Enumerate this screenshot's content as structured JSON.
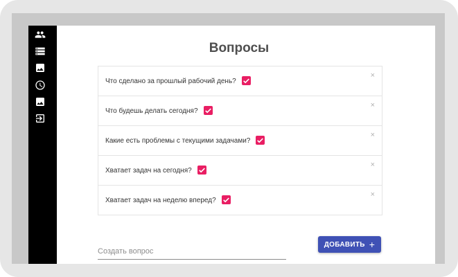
{
  "page": {
    "title": "Вопросы"
  },
  "sidebar": {
    "items": [
      {
        "icon": "people-icon"
      },
      {
        "icon": "storage-icon"
      },
      {
        "icon": "image-icon"
      },
      {
        "icon": "clock-icon"
      },
      {
        "icon": "image-icon"
      },
      {
        "icon": "exit-icon"
      }
    ]
  },
  "questions": [
    {
      "text": "Что сделано за прошлый рабочий день?",
      "checked": true,
      "remove": "×"
    },
    {
      "text": "Что будешь делать сегодня?",
      "checked": true,
      "remove": "×"
    },
    {
      "text": "Какие есть проблемы с текущими задачами?",
      "checked": true,
      "remove": "×"
    },
    {
      "text": "Хватает задач на сегодня?",
      "checked": true,
      "remove": "×"
    },
    {
      "text": "Хватает задач на неделю вперед?",
      "checked": true,
      "remove": "×"
    }
  ],
  "form": {
    "placeholder": "Создать вопрос",
    "add_label": "ДОБАВИТЬ",
    "add_icon": "+"
  },
  "colors": {
    "accent": "#e91e63",
    "primary": "#3f51b5",
    "sidebar": "#000000"
  }
}
